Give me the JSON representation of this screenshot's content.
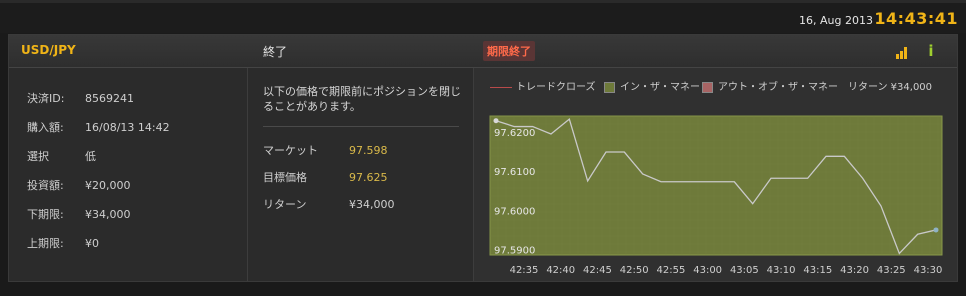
{
  "top": {
    "date": "16, Aug 2013",
    "time": "14:43:41"
  },
  "header": {
    "pair": "USD/JPY",
    "status": "終了",
    "badge": "期限終了"
  },
  "details": [
    {
      "label": "決済ID:",
      "value": "8569241"
    },
    {
      "label": "購入額:",
      "value": "16/08/13 14:42"
    },
    {
      "label": "選択",
      "value": "低"
    },
    {
      "label": "投資額:",
      "value": "¥20,000"
    },
    {
      "label": "下期限:",
      "value": "¥34,000"
    },
    {
      "label": "上期限:",
      "value": "¥0"
    }
  ],
  "middle": {
    "note": "以下の価格で期限前にポジションを閉じることがあります。",
    "market_label": "マーケット",
    "market_value": "97.598",
    "target_label": "目標価格",
    "target_value": "97.625",
    "return_label": "リターン",
    "return_value": "¥34,000"
  },
  "legend": {
    "trade_close": "トレードクローズ",
    "in_money": "イン・ザ・マネー",
    "out_money": "アウト・オブ・ザ・マネー",
    "return": "リターン ¥34,000"
  },
  "colors": {
    "accent": "#f0b417",
    "in_money": "#6e7a3a",
    "out_money": "#a86464",
    "line": "#c9c9c9"
  },
  "chart_data": {
    "type": "line",
    "ylim": [
      97.5886,
      97.6241
    ],
    "yticks": [
      "97.6200",
      "97.6100",
      "97.6000",
      "97.5900"
    ],
    "ytick_values": [
      97.62,
      97.61,
      97.6,
      97.59
    ],
    "categories": [
      "42:35",
      "42:40",
      "42:45",
      "42:50",
      "42:55",
      "43:00",
      "43:05",
      "43:10",
      "43:15",
      "43:20",
      "43:25",
      "43:30"
    ],
    "x": [
      0,
      1,
      2,
      3,
      4,
      5,
      6,
      7,
      8,
      9,
      10,
      11,
      12,
      13,
      14,
      15,
      16,
      17,
      18,
      19,
      20,
      21,
      22,
      23,
      24,
      25,
      26,
      27,
      28,
      29,
      30
    ],
    "y": [
      97.6229,
      97.6214,
      97.6214,
      97.6195,
      97.6233,
      97.6075,
      97.6149,
      97.6149,
      97.6093,
      97.6073,
      97.6073,
      97.6073,
      97.6073,
      97.6073,
      97.6017,
      97.6082,
      97.6082,
      97.6082,
      97.6138,
      97.6138,
      97.6082,
      97.6011,
      97.589,
      97.5939,
      97.595
    ],
    "xlabel": "",
    "ylabel": ""
  }
}
